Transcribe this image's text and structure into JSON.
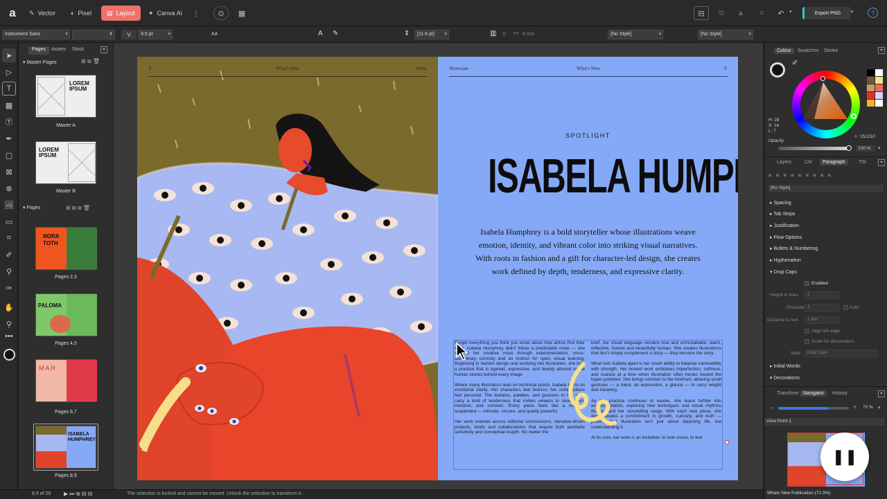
{
  "topbar": {
    "personas": [
      {
        "label": "Vector"
      },
      {
        "label": "Pixel"
      },
      {
        "label": "Layout"
      },
      {
        "label": "Canva AI"
      }
    ],
    "export_label": "Export PNG"
  },
  "context": {
    "font_family": "Instrument Sans",
    "font_style": "",
    "font_size": "9.5 pt",
    "leading": "[11.6 pt]",
    "columns": "0",
    "gutter": "4 mm",
    "para_style": "[No Style]",
    "char_style": "[No Style]",
    "aa": "AA"
  },
  "pages_panel": {
    "tabs": [
      "Pages",
      "Assets",
      "Stock"
    ],
    "master_header": "Master Pages",
    "masters": [
      {
        "label": "Master A",
        "thumb_text": "LOREM IPSUM"
      },
      {
        "label": "Master B",
        "thumb_text": "LOREM IPSUM"
      }
    ],
    "pages_header": "Pages",
    "pages": [
      {
        "label": "Pages 2,3",
        "thumb_text": "NORA TOTH",
        "bg": "#f0541f"
      },
      {
        "label": "Pages 4,5",
        "thumb_text": "PALOMA",
        "bg": "#7ec86a"
      },
      {
        "label": "Pages 6,7",
        "thumb_text": "M A R",
        "bg": "#f2b9a6"
      },
      {
        "label": "Pages 8,9",
        "thumb_text": "ISABELA HUMPHREY",
        "bg": "#86a9f7"
      }
    ]
  },
  "spread": {
    "left_header": {
      "num": "8",
      "center": "What's New",
      "right": "Artist"
    },
    "right_header": {
      "left": "Showcase",
      "center": "What's New",
      "num": "9"
    },
    "kicker": "SPOTLIGHT",
    "title": "ISABELA HUMPHREY",
    "intro": "Isabela Humphrey is a bold storyteller whose illustrations weave emotion, identity, and vibrant color into striking visual narratives. With roots in fashion and a gift for character-led design, she creates work defined by depth, tenderness, and expressive clarity.",
    "col1": "Forget everything you think you know about how artists find their style. Isabela Humphrey didn't follow a predictable route — she shaped her creative voice through experimentation, cross-disciplinary curiosity and an instinct for open, visual learning. Beginning in fashion design and evolving into illustration, she built a practice that is layered, expressive, and deeply attuned to the human stories behind every image.\n\nWhere many illustrators lean on technical polish, Isabela leans on emotional clarity. Her characters feel lived-in; her compositions feel personal. The textures, palettes, and gestures in her work carry a kind of tenderness that invites viewers to slow down, interpret, and connect. Every piece feels like a moment suspended — intimate, sincere, and quietly powerful.\n\nHer work extends across editorial commissions, narrative-driven projects, briefs and collaborations that require both aesthetic sensitivity and conceptual insight. No matter the",
    "col2": "brief, her visual language remains true and unmistakable: warm, reflective, honest and beautifully human. She creates illustrations that don't simply complement a story — they become the story.\n\nWhat sets Isabela apart is her smart ability to balance vulnerability with strength. Her honest work embraces imperfection, softness, and nuance at a time when illustration often trends toward the hyper-polished. She brings emotion to the forefront, allowing small gestures — a hand, an expression, a glance — to carry weight and meaning.\n\nAs her practice continues to evolve, she leans further into experimentation, exploring new techniques and visual rhythms that expand her storytelling range. With each new piece, she demonstrates a commitment to growth, curiosity, and truth — proving that illustration isn't just about depicting life, but understanding it.\n\nAt its core, her work is an invitation: to look closer, to feel"
  },
  "status": {
    "page": "8,9 of 29",
    "message": "The selection is locked and cannot be moved. Unlock the selection to transform it."
  },
  "right_panel": {
    "color_tabs": [
      "Colour",
      "Swatches",
      "Stroke"
    ],
    "hsl": {
      "h": "H: 28",
      "s": "S: 14",
      "l": "L: 7"
    },
    "hex": "151210",
    "opacity_label": "Opacity",
    "opacity_value": "100 %",
    "opacity": 1.0,
    "para_tabs": [
      "Layers",
      "Chr",
      "Paragraph",
      "TSt"
    ],
    "para_style": "[No Style]",
    "sections": [
      "Spacing",
      "Tab Stops",
      "Justification",
      "Flow Options",
      "Bullets & Numbering",
      "Hyphenation"
    ],
    "dropcaps": {
      "label": "Drop Caps",
      "enabled": "Enabled",
      "height_label": "Height in lines",
      "height_value": "1",
      "chars_label": "Characters",
      "chars_value": "1",
      "auto": "Auto",
      "dist_label": "Distance to text",
      "dist_value": "1 mm",
      "align": "Align left edge",
      "scale": "Scale for descenders",
      "style_label": "Style",
      "style_value": "Drop Caps"
    },
    "more_sections": [
      "Initial Words",
      "Decorations"
    ],
    "nav_tabs": [
      "Transform",
      "Navigator",
      "History"
    ],
    "zoom_value": "72 %",
    "zoom": 0.72,
    "view_point": "View Point 1",
    "doc_title": "Whats New Publication (72.3%)"
  },
  "colors": {
    "accent": "#f0716a",
    "right_page": "#86a9f7",
    "swatches": [
      "#000000",
      "#ffffff",
      "#6e5a2e",
      "#f7e08a",
      "#c89a64",
      "#f06a5a",
      "#e0312a",
      "#d4d4ff",
      "#efb42a",
      "#ffffff"
    ]
  }
}
